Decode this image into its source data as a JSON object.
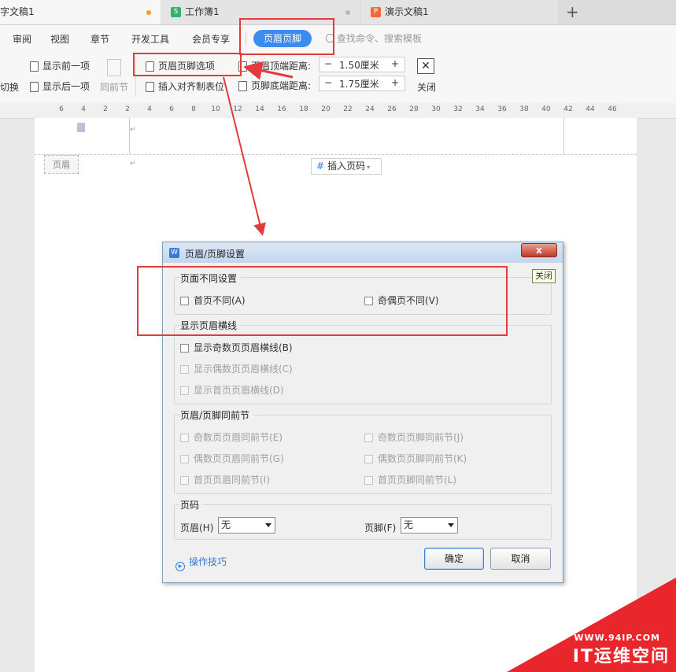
{
  "tabs": [
    {
      "label": "字文稿1",
      "dot_color": "#f0a020"
    },
    {
      "label": "工作簿1",
      "icon": "S",
      "icon_color": "#2eb36b"
    },
    {
      "label": "演示文稿1",
      "icon": "P",
      "icon_color": "#f26a3a"
    }
  ],
  "new_tab_glyph": "+",
  "menu": [
    "审阅",
    "视图",
    "章节",
    "开发工具",
    "会员专享",
    "页眉页脚"
  ],
  "search_placeholder": "查找命令、搜索模板",
  "toolbar": {
    "switch_label": "切换",
    "prev_label": "显示前一项",
    "next_label": "显示后一项",
    "same_prev_label": "同前节",
    "hf_options_label": "页眉页脚选项",
    "insert_tab_label": "插入对齐制表位",
    "header_top_label": "页眉顶端距离:",
    "header_top_value": "1.50厘米",
    "footer_bottom_label": "页脚底端距离:",
    "footer_bottom_value": "1.75厘米",
    "close_label": "关闭",
    "minus": "−",
    "plus": "+"
  },
  "ruler": [
    "6",
    "4",
    "2",
    "2",
    "4",
    "6",
    "8",
    "10",
    "12",
    "14",
    "16",
    "18",
    "20",
    "22",
    "24",
    "26",
    "28",
    "30",
    "32",
    "34",
    "36",
    "38",
    "40",
    "42",
    "44",
    "46"
  ],
  "page": {
    "header_tag": "页眉",
    "insert_page_number": "插入页码"
  },
  "dialog": {
    "app_icon": "W",
    "title": "页眉/页脚设置",
    "close_glyph": "x",
    "tooltip": "关闭",
    "group1": {
      "title": "页面不同设置",
      "first_page": "首页不同(A)",
      "odd_even": "奇偶页不同(V)"
    },
    "group2": {
      "title": "显示页眉横线",
      "odd": "显示奇数页页眉横线(B)",
      "even": "显示偶数页页眉横线(C)",
      "first": "显示首页页眉横线(D)"
    },
    "group3": {
      "title": "页眉/页脚同前节",
      "odd_header": "奇数页页眉同前节(E)",
      "odd_footer": "奇数页页脚同前节(J)",
      "even_header": "偶数页页眉同前节(G)",
      "even_footer": "偶数页页脚同前节(K)",
      "first_header": "首页页眉同前节(I)",
      "first_footer": "首页页脚同前节(L)"
    },
    "group4": {
      "title": "页码",
      "header_label": "页眉(H)",
      "header_value": "无",
      "footer_label": "页脚(F)",
      "footer_value": "无"
    },
    "tips": "操作技巧",
    "ok": "确定",
    "cancel": "取消"
  },
  "watermark": {
    "url": "WWW.94IP.COM",
    "brand": "IT运维空间"
  },
  "colors": {
    "accent": "#3c8cf0",
    "annotation": "#e33b3b"
  }
}
